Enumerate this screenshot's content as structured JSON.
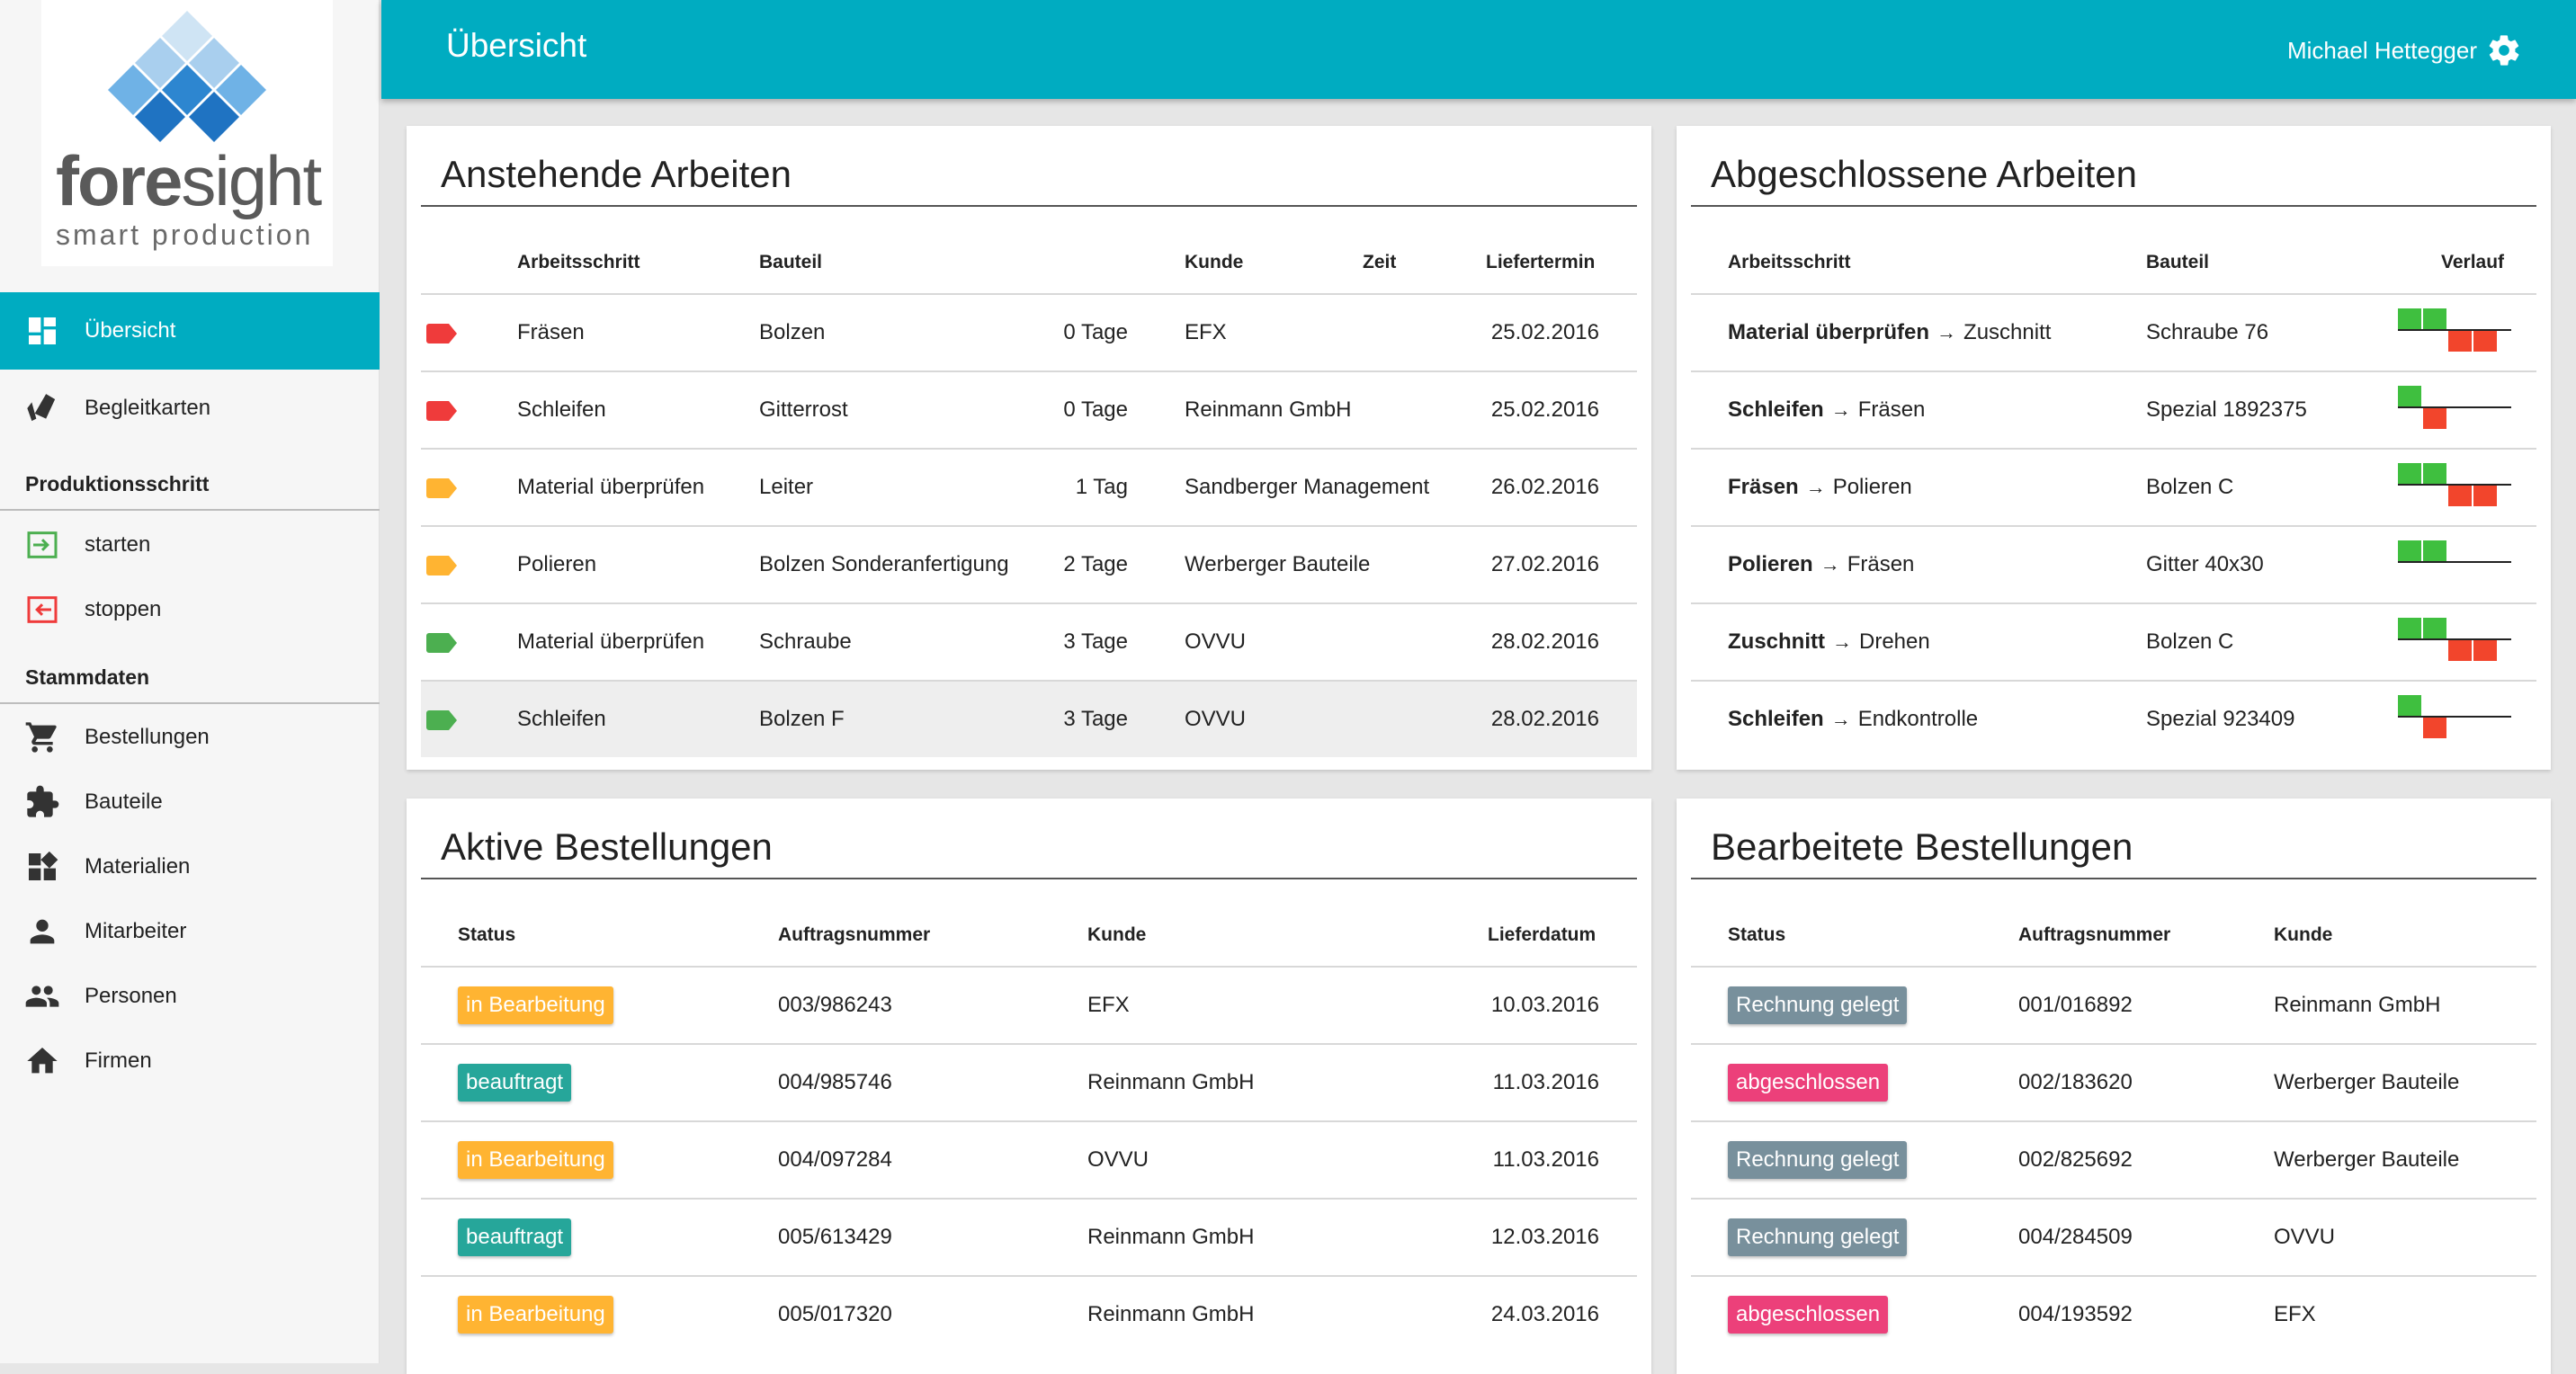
{
  "logo": {
    "brand": "foresight",
    "tagline": "smart production"
  },
  "nav": {
    "items": [
      {
        "label": "Übersicht",
        "icon": "dashboard-icon"
      },
      {
        "label": "Begleitkarten",
        "icon": "tag-cards-icon"
      }
    ],
    "section_production": "Produktionsschritt",
    "production_items": [
      {
        "label": "starten",
        "icon": "enter-icon"
      },
      {
        "label": "stoppen",
        "icon": "exit-icon"
      }
    ],
    "section_master": "Stammdaten",
    "master_items": [
      {
        "label": "Bestellungen",
        "icon": "cart-icon"
      },
      {
        "label": "Bauteile",
        "icon": "puzzle-icon"
      },
      {
        "label": "Materialien",
        "icon": "widgets-icon"
      },
      {
        "label": "Mitarbeiter",
        "icon": "person-icon"
      },
      {
        "label": "Personen",
        "icon": "people-icon"
      },
      {
        "label": "Firmen",
        "icon": "home-icon"
      }
    ]
  },
  "header": {
    "title": "Übersicht",
    "user": "Michael Hettegger"
  },
  "colors": {
    "accent": "#00acc1",
    "red": "#ef3b3b",
    "orange": "#ffb432",
    "green": "#4caf50",
    "teal": "#26a69a",
    "grey": "#78909c",
    "pink": "#ec407a"
  },
  "pending": {
    "title": "Anstehende Arbeiten",
    "headers": {
      "step": "Arbeitsschritt",
      "part": "Bauteil",
      "time": "Zeit",
      "customer": "Kunde",
      "date": "Liefertermin"
    },
    "rows": [
      {
        "priority": "red",
        "step": "Fräsen",
        "part": "Bolzen",
        "time": "0 Tage",
        "customer": "EFX",
        "date": "25.02.2016"
      },
      {
        "priority": "red",
        "step": "Schleifen",
        "part": "Gitterrost",
        "time": "0 Tage",
        "customer": "Reinmann GmbH",
        "date": "25.02.2016"
      },
      {
        "priority": "orange",
        "step": "Material überprüfen",
        "part": "Leiter",
        "time": "1 Tag",
        "customer": "Sandberger Management",
        "date": "26.02.2016"
      },
      {
        "priority": "orange",
        "step": "Polieren",
        "part": "Bolzen Sonderanfertigung",
        "time": "2 Tage",
        "customer": "Werberger Bauteile",
        "date": "27.02.2016"
      },
      {
        "priority": "green",
        "step": "Material überprüfen",
        "part": "Schraube",
        "time": "3 Tage",
        "customer": "OVVU",
        "date": "28.02.2016"
      },
      {
        "priority": "green",
        "step": "Schleifen",
        "part": "Bolzen F",
        "time": "3 Tage",
        "customer": "OVVU",
        "date": "28.02.2016"
      }
    ]
  },
  "completed": {
    "title": "Abgeschlossene Arbeiten",
    "headers": {
      "step": "Arbeitsschritt",
      "part": "Bauteil",
      "trend": "Verlauf"
    },
    "rows": [
      {
        "from": "Material überprüfen",
        "to": "Zuschnitt",
        "part": "Schraube 76",
        "trend": [
          2,
          -2
        ]
      },
      {
        "from": "Schleifen",
        "to": "Fräsen",
        "part": "Spezial 1892375",
        "trend": [
          1,
          -1
        ]
      },
      {
        "from": "Fräsen",
        "to": "Polieren",
        "part": "Bolzen C",
        "trend": [
          2,
          -2
        ]
      },
      {
        "from": "Polieren",
        "to": "Fräsen",
        "part": "Gitter 40x30",
        "trend": [
          2,
          0
        ]
      },
      {
        "from": "Zuschnitt",
        "to": "Drehen",
        "part": "Bolzen C",
        "trend": [
          2,
          -2
        ]
      },
      {
        "from": "Schleifen",
        "to": "Endkontrolle",
        "part": "Spezial 923409",
        "trend": [
          1,
          -1
        ]
      }
    ]
  },
  "active_orders": {
    "title": "Aktive Bestellungen",
    "headers": {
      "status": "Status",
      "order": "Auftragsnummer",
      "customer": "Kunde",
      "date": "Lieferdatum"
    },
    "rows": [
      {
        "status": "in Bearbeitung",
        "status_color": "orange",
        "order": "003/986243",
        "customer": "EFX",
        "date": "10.03.2016"
      },
      {
        "status": "beauftragt",
        "status_color": "teal",
        "order": "004/985746",
        "customer": "Reinmann GmbH",
        "date": "11.03.2016"
      },
      {
        "status": "in Bearbeitung",
        "status_color": "orange",
        "order": "004/097284",
        "customer": "OVVU",
        "date": "11.03.2016"
      },
      {
        "status": "beauftragt",
        "status_color": "teal",
        "order": "005/613429",
        "customer": "Reinmann GmbH",
        "date": "12.03.2016"
      },
      {
        "status": "in Bearbeitung",
        "status_color": "orange",
        "order": "005/017320",
        "customer": "Reinmann GmbH",
        "date": "24.03.2016"
      }
    ]
  },
  "processed_orders": {
    "title": "Bearbeitete Bestellungen",
    "headers": {
      "status": "Status",
      "order": "Auftragsnummer",
      "customer": "Kunde"
    },
    "rows": [
      {
        "status": "Rechnung gelegt",
        "status_color": "grey",
        "order": "001/016892",
        "customer": "Reinmann GmbH"
      },
      {
        "status": "abgeschlossen",
        "status_color": "pink",
        "order": "002/183620",
        "customer": "Werberger Bauteile"
      },
      {
        "status": "Rechnung gelegt",
        "status_color": "grey",
        "order": "002/825692",
        "customer": "Werberger Bauteile"
      },
      {
        "status": "Rechnung gelegt",
        "status_color": "grey",
        "order": "004/284509",
        "customer": "OVVU"
      },
      {
        "status": "abgeschlossen",
        "status_color": "pink",
        "order": "004/193592",
        "customer": "EFX"
      }
    ]
  }
}
